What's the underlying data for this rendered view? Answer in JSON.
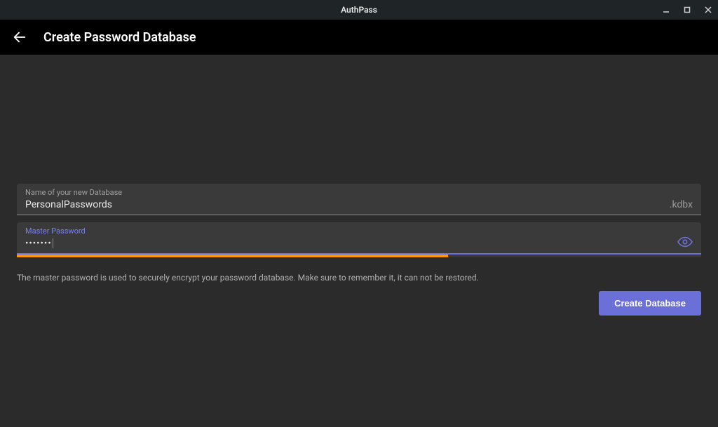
{
  "window": {
    "title": "AuthPass"
  },
  "appbar": {
    "page_title": "Create Password Database"
  },
  "form": {
    "db_name": {
      "label": "Name of your new Database",
      "value": "PersonalPasswords",
      "suffix": ".kdbx"
    },
    "master_password": {
      "label": "Master Password",
      "value_masked": "•••••••"
    },
    "strength_percent": 63,
    "helper_text": "The master password is used to securely encrypt your password database. Make sure to remember it, it can not be restored.",
    "submit_label": "Create Database"
  }
}
